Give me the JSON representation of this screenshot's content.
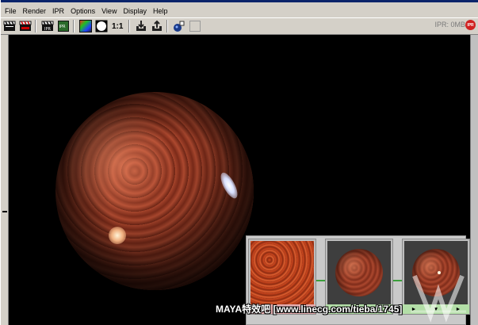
{
  "menu": {
    "items": [
      "File",
      "Render",
      "IPR",
      "Options",
      "View",
      "Display",
      "Help"
    ]
  },
  "toolbar": {
    "buttons": [
      {
        "icon": "clapper-icon"
      },
      {
        "icon": "redo-render-icon"
      },
      {
        "icon": "ipr-render-icon"
      },
      {
        "icon": "ipr-refresh-icon"
      },
      {
        "icon": "rgb-channel-icon"
      },
      {
        "icon": "alpha-channel-icon"
      },
      {
        "icon": "keep-image-icon"
      },
      {
        "icon": "remove-image-icon"
      },
      {
        "icon": "snapshot-icon"
      },
      {
        "icon": "empty-slot-icon"
      }
    ],
    "ratio_label": "1:1"
  },
  "status": {
    "memory": "IPR: 0MB",
    "badge": "IPR"
  },
  "colors": {
    "frame": "#d4d0c8",
    "viewport": "#000000",
    "accent_red": "#d02020",
    "node_pink": "#e7aeb0",
    "node_green": "#b3dea7"
  },
  "hypershade": {
    "nodes": [
      {
        "type": "fractal-texture",
        "footer": [
          "►",
          "▼",
          "►"
        ]
      },
      {
        "type": "material-ball",
        "footer": [
          "►",
          "▼",
          "►"
        ]
      },
      {
        "type": "shading-group",
        "footer": [
          "►",
          "▼",
          "►"
        ]
      }
    ]
  },
  "watermark": "MAYA特效吧 [www.linecg.com/tieba/1745]"
}
